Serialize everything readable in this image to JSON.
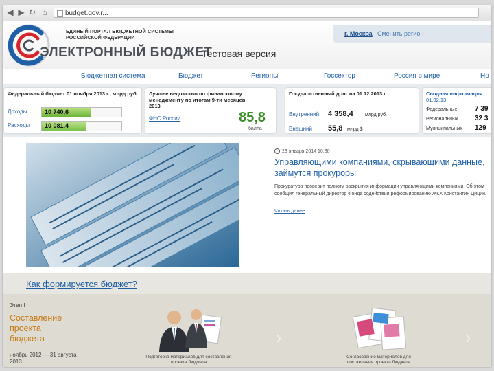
{
  "browser": {
    "url": "budget.gov.r..."
  },
  "header": {
    "portal_line1": "ЕДИНЫЙ ПОРТАЛ БЮДЖЕТНОЙ СИСТЕМЫ",
    "portal_line2": "РОССИЙСКОЙ ФЕДЕРАЦИИ",
    "brand": "ЭЛЕКТРОННЫЙ БЮДЖЕТ",
    "test_version": "Тестовая версия",
    "city": "г. Москва",
    "city_change": "Сменить регион",
    "accent_colors": [
      "#1f5fa6",
      "#d7262b",
      "#4a4f57"
    ]
  },
  "menu": {
    "items": [
      {
        "label": "Бюджетная система"
      },
      {
        "label": "Бюджет"
      },
      {
        "label": "Регионы"
      },
      {
        "label": "Госсектор"
      },
      {
        "label": "Россия в мире"
      },
      {
        "label": "Но"
      }
    ]
  },
  "cards": {
    "federal": {
      "title": "Федеральный бюджет 01 ноября 2013 г., млрд руб.",
      "income_label": "Доходы",
      "income_value": "10 740,6",
      "income_fill": 0.62,
      "expense_label": "Расходы",
      "expense_value": "10 081,4",
      "expense_fill": 0.56
    },
    "ministry": {
      "title": "Лучшее ведомство по финансовому менеджменту по итогам 9-ти месяцев 2013",
      "name": "ФНС России",
      "score": "85,8",
      "score_unit": "балла"
    },
    "debt": {
      "title": "Государственный долг на 01.12.2013 г.",
      "internal_label": "Внутренний",
      "internal_value": "4 358,4",
      "internal_unit": "млрд руб.",
      "external_label": "Внешний",
      "external_value": "55,8",
      "external_unit": "млрд $"
    },
    "summary": {
      "title": "Сводная информация",
      "date": "01.02.13",
      "rows": [
        {
          "label": "Федеральных",
          "value": "7 39"
        },
        {
          "label": "Региональных",
          "value": "32 3"
        },
        {
          "label": "Муниципальных",
          "value": "129"
        }
      ]
    }
  },
  "news": {
    "date": "23 января 2014 10:30",
    "title": "Управляющими компаниями, скрывающими данные, займутся прокуроры",
    "body": "Прокуратура проверит полноту раскрытия информации управляющими компаниями. Об этом сообщил генеральный директор Фонда содействия реформированию ЖКХ Константин Цицин.",
    "more": "Читать далее"
  },
  "budget_section": {
    "how_link": "Как формируется бюджет?",
    "stage_label": "Этап I",
    "stage_title": "Составление проекта бюджета",
    "stage_dates": "ноябрь 2012 — 31 августа 2013",
    "caption1": "Подготовка материалов для составления проекта бюджета",
    "caption2": "Согласование материалов для составления проекта бюджета"
  }
}
